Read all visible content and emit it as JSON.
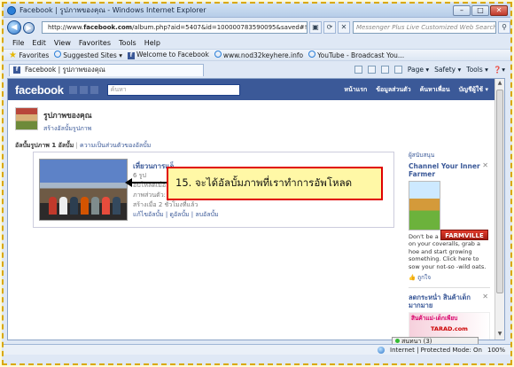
{
  "window": {
    "title": "Facebook | รูปภาพของคุณ - Windows Internet Explorer",
    "minimize": "–",
    "maximize": "□",
    "close": "✕"
  },
  "addressbar": {
    "url_prefix": "http://www.",
    "url_host": "facebook.com",
    "url_rest": "/album.php?aid=5407&id=100000783590095&saved#!/photos.php?id=...",
    "search_placeholder": "Messenger Plus Live Customized Web Search"
  },
  "menu": [
    "File",
    "Edit",
    "View",
    "Favorites",
    "Tools",
    "Help"
  ],
  "favorites": {
    "label": "Favorites",
    "items": [
      "Suggested Sites ▾",
      "Welcome to Facebook",
      "www.nod32keyhere.info",
      "YouTube - Broadcast You..."
    ]
  },
  "tab": {
    "title": "Facebook | รูปภาพของคุณ"
  },
  "commandbar": {
    "page": "Page ▾",
    "safety": "Safety ▾",
    "tools": "Tools ▾",
    "help": "❓▾"
  },
  "facebook": {
    "logo": "facebook",
    "search_placeholder": "ค้นหา",
    "nav": [
      "หน้าแรก",
      "ข้อมูลส่วนตัว",
      "ค้นหาเพื่อน",
      "บัญชีผู้ใช้ ▾"
    ],
    "page_title": "รูปภาพของคุณ",
    "create_album": "สร้างอัลบั้มรูปภาพ",
    "tabs_active": "อัลบั้มรูปภาพ 1 อัลบั้ม",
    "tabs_link": "ความเป็นส่วนตัวของอัลบั้ม",
    "tabs_sep": "|",
    "album": {
      "title": "เที่ยวนการแอ็",
      "count": "6 รูป",
      "line1": "อัปโหลดเมื่อ...",
      "line2": "ภาพส่วนตัว: ประเทศไทย",
      "line3": "สร้างเมื่อ 2 ชั่วโมงที่แล้ว",
      "actions": "แก้ไขอัลบั้ม | ดูอัลบั้ม | ลบอัลบั้ม"
    },
    "sidebar": {
      "sponsored": "ผู้สนับสนุน",
      "ad1_title": "Channel Your Inner Farmer",
      "farmville": "FARMVILLE",
      "ad1_body": "Don't be a city slicker! Pull on your coveralls, grab a hoe and start growing something. Click here to sow your not-so -wild oats.",
      "like": "ถูกใจ",
      "ad2_title": "ลดกระหน่ำ สินค้าเด็กมากมาย",
      "ad2_sub": "สินค้าแม่-เด็กเพียบ",
      "ad2_brand": "TARAD.com"
    },
    "chat": "สนทนา (3)"
  },
  "annotation": {
    "text": "15. จะได้อัลบั้มภาพที่เราทำการอัพโหลด"
  },
  "statusbar": {
    "zone": "Internet | Protected Mode: On",
    "zoom": "100%"
  }
}
